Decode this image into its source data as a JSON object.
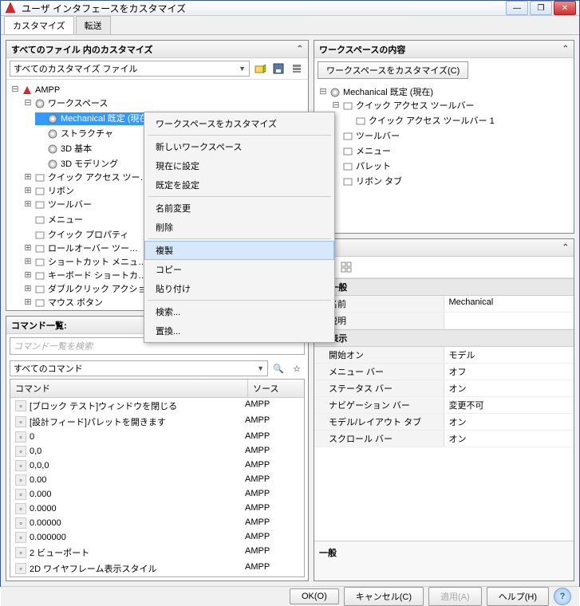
{
  "window": {
    "title": "ユーザ インタフェースをカスタマイズ"
  },
  "tabs": {
    "customize": "カスタマイズ",
    "transfer": "転送"
  },
  "leftTop": {
    "header": "すべてのファイル 内のカスタマイズ",
    "filter": "すべてのカスタマイズ ファイル",
    "tree": {
      "root": "AMPP",
      "workspace": "ワークスペース",
      "ws_items": [
        "Mechanical 既定 (現在)",
        "ストラクチャ",
        "3D 基本",
        "3D モデリング"
      ],
      "others": [
        "クイック アクセス ツー…",
        "リボン",
        "ツールバー",
        "メニュー",
        "クイック プロパティ",
        "ロールオーバー ツー…",
        "ショートカット メニュ…",
        "キーボード ショートカ…",
        "ダブルクリック アクショ…",
        "マウス ボタン"
      ]
    }
  },
  "context": {
    "items": [
      "ワークスペースをカスタマイズ",
      "新しいワークスペース",
      "現在に設定",
      "既定を設定",
      "名前変更",
      "削除",
      "複製",
      "コピー",
      "貼り付け",
      "検索...",
      "置換..."
    ],
    "highlight": 6
  },
  "cmdList": {
    "header": "コマンド一覧:",
    "placeholder": "コマンド一覧を検索",
    "filter": "すべてのコマンド",
    "cols": {
      "cmd": "コマンド",
      "src": "ソース"
    },
    "rows": [
      {
        "name": "[ブロック テスト]ウィンドウを閉じる",
        "src": "AMPP"
      },
      {
        "name": "[設計フィード]パレットを開きます",
        "src": "AMPP"
      },
      {
        "name": "0",
        "src": "AMPP"
      },
      {
        "name": "0,0",
        "src": "AMPP"
      },
      {
        "name": "0,0,0",
        "src": "AMPP"
      },
      {
        "name": "0.00",
        "src": "AMPP"
      },
      {
        "name": "0.000",
        "src": "AMPP"
      },
      {
        "name": "0.0000",
        "src": "AMPP"
      },
      {
        "name": "0.00000",
        "src": "AMPP"
      },
      {
        "name": "0.000000",
        "src": "AMPP"
      },
      {
        "name": "2 ビューポート",
        "src": "AMPP"
      },
      {
        "name": "2D ワイヤフレーム表示スタイル",
        "src": "AMPP"
      }
    ]
  },
  "rightTop": {
    "header": "ワークスペースの内容",
    "button": "ワークスペースをカスタマイズ(C)",
    "tree": {
      "root": "Mechanical 既定 (現在)",
      "qat": "クイック アクセス ツールバー",
      "qat1": "クイック アクセス ツールバー 1",
      "items": [
        "ツールバー",
        "メニュー",
        "パレット",
        "リボン タブ"
      ]
    }
  },
  "props": {
    "sect1": "一般",
    "rows1": [
      {
        "k": "名前",
        "v": "Mechanical"
      },
      {
        "k": "説明",
        "v": ""
      }
    ],
    "sect2": "表示",
    "rows2": [
      {
        "k": "開始オン",
        "v": "モデル"
      },
      {
        "k": "メニュー バー",
        "v": "オフ"
      },
      {
        "k": "ステータス バー",
        "v": "オン"
      },
      {
        "k": "ナビゲーション バー",
        "v": "変更不可"
      },
      {
        "k": "モデル/レイアウト タブ",
        "v": "オン"
      },
      {
        "k": "スクロール バー",
        "v": "オン"
      }
    ],
    "desc_title": "一般"
  },
  "footer": {
    "ok": "OK(O)",
    "cancel": "キャンセル(C)",
    "apply": "適用(A)",
    "help": "ヘルプ(H)"
  }
}
